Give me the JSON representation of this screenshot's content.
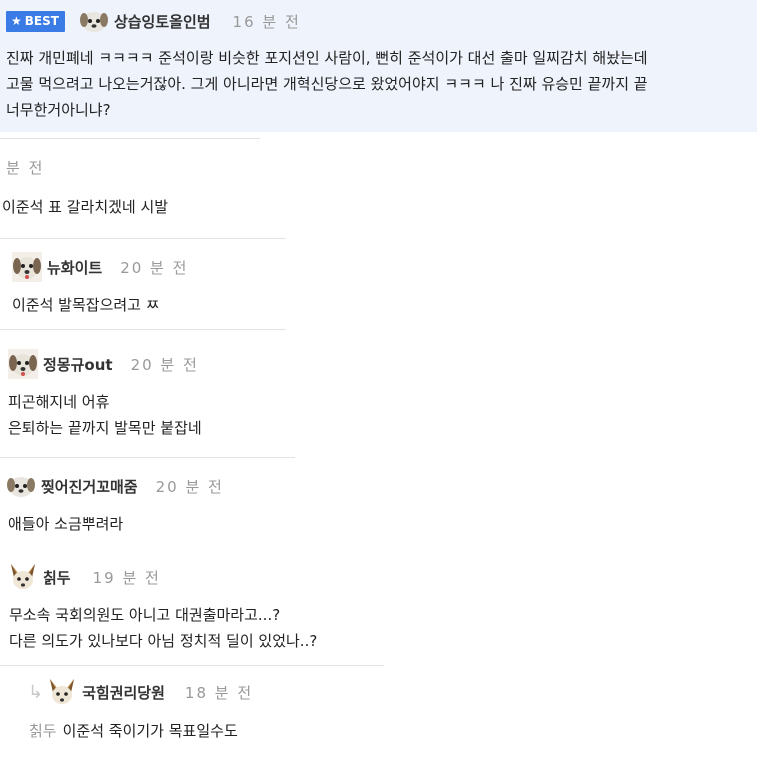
{
  "best": {
    "badge": "BEST",
    "nickname": "상습잉토올인범",
    "time": "16 분 전",
    "lines": [
      "진짜 개민폐네 ㅋㅋㅋㅋ 준석이랑 비슷한 포지션인 사람이, 뻔히 준석이가 대선 출마 일찌감치 해놨는데",
      "고물 먹으려고 나오는거잖아. 그게 아니라면 개혁신당으로 왔었어야지 ㅋㅋㅋ 나 진짜 유승민 끝까지 끝",
      "너무한거아니냐?"
    ]
  },
  "comments": [
    {
      "time": "분 전",
      "lines": [
        "이준석 표 갈라치겠네 시발"
      ]
    },
    {
      "nickname": "뉴화이트",
      "time": "20 분 전",
      "lines": [
        "이준석 발목잡으려고 ㅉ"
      ]
    },
    {
      "nickname": "정몽규out",
      "time": "20 분 전",
      "lines": [
        "피곤해지네 어휴",
        "은퇴하는 끝까지 발목만 붙잡네"
      ]
    },
    {
      "nickname": "찢어진거꼬매줌",
      "time": "20 분 전",
      "lines": [
        "애들아 소금뿌려라"
      ]
    },
    {
      "nickname": "칡두",
      "time": "19 분 전",
      "lines": [
        "무소속 국회의원도 아니고 대권출마라고...?",
        "다른 의도가 있나보다 아님 정치적 딜이 있었나..?"
      ]
    }
  ],
  "reply": {
    "nickname": "국힘권리당원",
    "time": "18 분 전",
    "mention": "칡두",
    "text": "이준석 죽이기가 목표일수도"
  },
  "colors": {
    "best_bg": "#eef3fc",
    "badge": "#3b7be6",
    "time": "#999999"
  },
  "icons": {
    "best_badge": "star-icon",
    "avatar_dog": "puppy-avatar-icon",
    "avatar_fox": "fox-avatar-icon",
    "reply": "reply-arrow-icon"
  }
}
